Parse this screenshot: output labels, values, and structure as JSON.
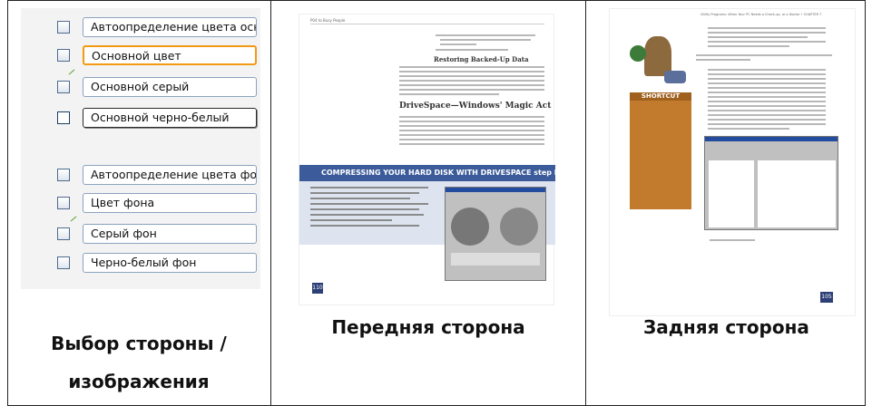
{
  "options": [
    {
      "label": "Автоопределение цвета осн",
      "checked": false
    },
    {
      "label": "Основной цвет",
      "checked": false,
      "highlight": true
    },
    {
      "label": "Основной серый",
      "checked": false
    },
    {
      "label": "Основной черно-белый",
      "checked": true,
      "focused": true
    },
    {
      "label": "Автоопределение цвета фон",
      "checked": false
    },
    {
      "label": "Цвет фона",
      "checked": false
    },
    {
      "label": "Серый фон",
      "checked": false
    },
    {
      "label": "Черно-белый фон",
      "checked": false
    }
  ],
  "captions": {
    "col1_line1": "Выбор стороны /",
    "col1_line2": "изображения",
    "col2": "Передняя сторона",
    "col3": "Задняя сторона"
  },
  "front_page": {
    "header": "P04 to Busy People",
    "heading1": "Restoring Backed-Up Data",
    "heading2": "DriveSpace—Windows' Magic Act",
    "banner": "COMPRESSING YOUR HARD DISK WITH DRIVESPACE step by step",
    "page_number": "110"
  },
  "back_page": {
    "header": "Utility Programs: When Your PC Needs a Check-up, or a Doctor • CHAPTER 7",
    "shortcut": "SHORTCUT",
    "page_number": "105"
  },
  "colors": {
    "highlight": "#f29a14",
    "banner": "#3b5b9a",
    "shortcut": "#a0601e"
  }
}
